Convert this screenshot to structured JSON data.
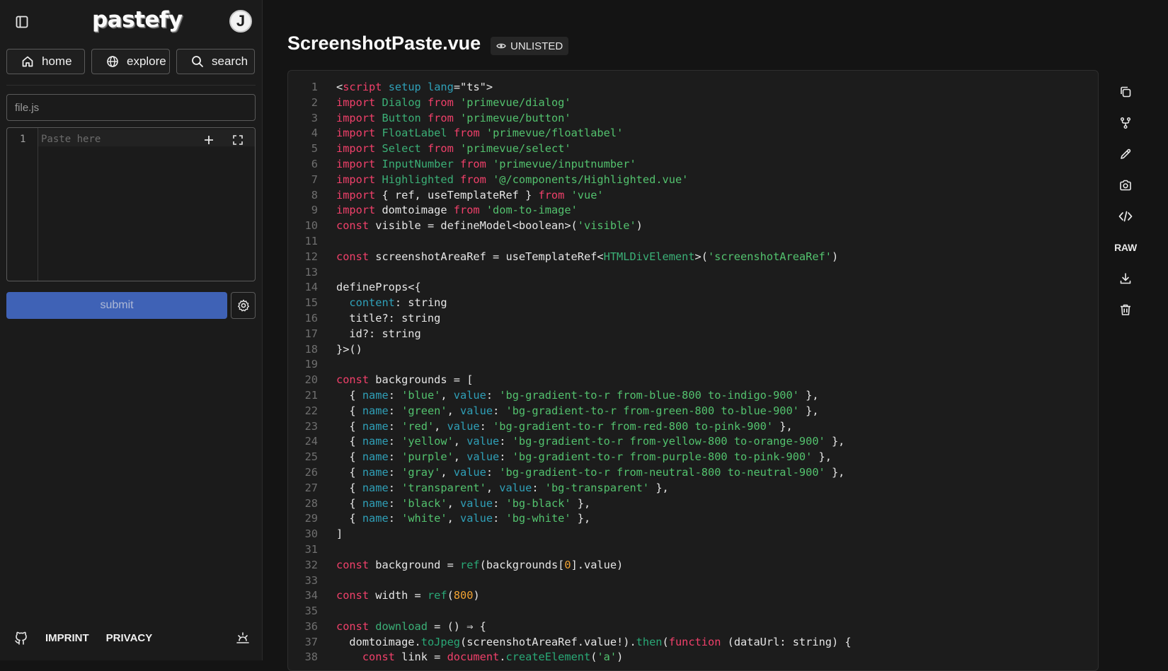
{
  "app": {
    "logo": "pastefy",
    "avatar_initial": "J"
  },
  "nav": {
    "home": "home",
    "explore": "explore",
    "search": "search"
  },
  "editor": {
    "filename_placeholder": "file.js",
    "line_number": "1",
    "paste_placeholder": "Paste here",
    "submit_label": "submit"
  },
  "footer": {
    "imprint": "IMPRINT",
    "privacy": "PRIVACY"
  },
  "paste": {
    "title": "ScreenshotPaste.vue",
    "visibility": "UNLISTED"
  },
  "actions": {
    "raw_label": "RAW"
  },
  "icons": {
    "sidebar_toggle": "sidebar-toggle-icon",
    "home": "home-icon",
    "explore": "globe-icon",
    "search": "search-icon",
    "add": "plus-icon",
    "fullscreen": "fullscreen-icon",
    "settings": "gear-icon",
    "github": "github-icon",
    "theme": "theme-icon",
    "visibility": "eye-icon",
    "copy": "copy-icon",
    "fork": "fork-icon",
    "edit": "pencil-icon",
    "screenshot": "camera-icon",
    "embed": "code-icon",
    "download": "download-icon",
    "delete": "trash-icon"
  },
  "colors": {
    "background": "#141414",
    "sidebar": "#1b1b1b",
    "submit": "#3f62b6",
    "keyword": "#f0406a",
    "string": "#53c26e",
    "identifier": "#3bb077",
    "property": "#2fa0b8",
    "number": "#f2a332"
  },
  "code_lines": [
    [
      {
        "t": "<",
        "c": ""
      },
      {
        "t": "script",
        "c": "kw"
      },
      {
        "t": " ",
        "c": ""
      },
      {
        "t": "setup",
        "c": "prop"
      },
      {
        "t": " ",
        "c": ""
      },
      {
        "t": "lang",
        "c": "prop"
      },
      {
        "t": "=\"ts\">",
        "c": ""
      }
    ],
    [
      {
        "t": "import",
        "c": "kw"
      },
      {
        "t": " ",
        "c": ""
      },
      {
        "t": "Dialog",
        "c": "id"
      },
      {
        "t": " ",
        "c": ""
      },
      {
        "t": "from",
        "c": "kw"
      },
      {
        "t": " ",
        "c": ""
      },
      {
        "t": "'primevue/dialog'",
        "c": "str"
      }
    ],
    [
      {
        "t": "import",
        "c": "kw"
      },
      {
        "t": " ",
        "c": ""
      },
      {
        "t": "Button",
        "c": "id"
      },
      {
        "t": " ",
        "c": ""
      },
      {
        "t": "from",
        "c": "kw"
      },
      {
        "t": " ",
        "c": ""
      },
      {
        "t": "'primevue/button'",
        "c": "str"
      }
    ],
    [
      {
        "t": "import",
        "c": "kw"
      },
      {
        "t": " ",
        "c": ""
      },
      {
        "t": "FloatLabel",
        "c": "id"
      },
      {
        "t": " ",
        "c": ""
      },
      {
        "t": "from",
        "c": "kw"
      },
      {
        "t": " ",
        "c": ""
      },
      {
        "t": "'primevue/floatlabel'",
        "c": "str"
      }
    ],
    [
      {
        "t": "import",
        "c": "kw"
      },
      {
        "t": " ",
        "c": ""
      },
      {
        "t": "Select",
        "c": "id"
      },
      {
        "t": " ",
        "c": ""
      },
      {
        "t": "from",
        "c": "kw"
      },
      {
        "t": " ",
        "c": ""
      },
      {
        "t": "'primevue/select'",
        "c": "str"
      }
    ],
    [
      {
        "t": "import",
        "c": "kw"
      },
      {
        "t": " ",
        "c": ""
      },
      {
        "t": "InputNumber",
        "c": "id"
      },
      {
        "t": " ",
        "c": ""
      },
      {
        "t": "from",
        "c": "kw"
      },
      {
        "t": " ",
        "c": ""
      },
      {
        "t": "'primevue/inputnumber'",
        "c": "str"
      }
    ],
    [
      {
        "t": "import",
        "c": "kw"
      },
      {
        "t": " ",
        "c": ""
      },
      {
        "t": "Highlighted",
        "c": "id"
      },
      {
        "t": " ",
        "c": ""
      },
      {
        "t": "from",
        "c": "kw"
      },
      {
        "t": " ",
        "c": ""
      },
      {
        "t": "'@/components/Highlighted.vue'",
        "c": "str"
      }
    ],
    [
      {
        "t": "import",
        "c": "kw"
      },
      {
        "t": " { ref, useTemplateRef } ",
        "c": ""
      },
      {
        "t": "from",
        "c": "kw"
      },
      {
        "t": " ",
        "c": ""
      },
      {
        "t": "'vue'",
        "c": "str"
      }
    ],
    [
      {
        "t": "import",
        "c": "kw"
      },
      {
        "t": " domtoimage ",
        "c": ""
      },
      {
        "t": "from",
        "c": "kw"
      },
      {
        "t": " ",
        "c": ""
      },
      {
        "t": "'dom-to-image'",
        "c": "str"
      }
    ],
    [
      {
        "t": "const",
        "c": "kw"
      },
      {
        "t": " visible = defineModel<boolean>(",
        "c": ""
      },
      {
        "t": "'visible'",
        "c": "str"
      },
      {
        "t": ")",
        "c": ""
      }
    ],
    [],
    [
      {
        "t": "const",
        "c": "kw"
      },
      {
        "t": " screenshotAreaRef = useTemplateRef<",
        "c": ""
      },
      {
        "t": "HTMLDivElement",
        "c": "id"
      },
      {
        "t": ">(",
        "c": ""
      },
      {
        "t": "'screenshotAreaRef'",
        "c": "str"
      },
      {
        "t": ")",
        "c": ""
      }
    ],
    [],
    [
      {
        "t": "defineProps<{",
        "c": ""
      }
    ],
    [
      {
        "t": "  ",
        "c": ""
      },
      {
        "t": "content",
        "c": "prop"
      },
      {
        "t": ": string",
        "c": ""
      }
    ],
    [
      {
        "t": "  title?: string",
        "c": ""
      }
    ],
    [
      {
        "t": "  id?: string",
        "c": ""
      }
    ],
    [
      {
        "t": "}>()",
        "c": ""
      }
    ],
    [],
    [
      {
        "t": "const",
        "c": "kw"
      },
      {
        "t": " backgrounds = [",
        "c": ""
      }
    ],
    [
      {
        "t": "  { ",
        "c": ""
      },
      {
        "t": "name",
        "c": "prop"
      },
      {
        "t": ": ",
        "c": ""
      },
      {
        "t": "'blue'",
        "c": "str"
      },
      {
        "t": ", ",
        "c": ""
      },
      {
        "t": "value",
        "c": "prop"
      },
      {
        "t": ": ",
        "c": ""
      },
      {
        "t": "'bg-gradient-to-r from-blue-800 to-indigo-900'",
        "c": "str"
      },
      {
        "t": " },",
        "c": ""
      }
    ],
    [
      {
        "t": "  { ",
        "c": ""
      },
      {
        "t": "name",
        "c": "prop"
      },
      {
        "t": ": ",
        "c": ""
      },
      {
        "t": "'green'",
        "c": "str"
      },
      {
        "t": ", ",
        "c": ""
      },
      {
        "t": "value",
        "c": "prop"
      },
      {
        "t": ": ",
        "c": ""
      },
      {
        "t": "'bg-gradient-to-r from-green-800 to-blue-900'",
        "c": "str"
      },
      {
        "t": " },",
        "c": ""
      }
    ],
    [
      {
        "t": "  { ",
        "c": ""
      },
      {
        "t": "name",
        "c": "prop"
      },
      {
        "t": ": ",
        "c": ""
      },
      {
        "t": "'red'",
        "c": "str"
      },
      {
        "t": ", ",
        "c": ""
      },
      {
        "t": "value",
        "c": "prop"
      },
      {
        "t": ": ",
        "c": ""
      },
      {
        "t": "'bg-gradient-to-r from-red-800 to-pink-900'",
        "c": "str"
      },
      {
        "t": " },",
        "c": ""
      }
    ],
    [
      {
        "t": "  { ",
        "c": ""
      },
      {
        "t": "name",
        "c": "prop"
      },
      {
        "t": ": ",
        "c": ""
      },
      {
        "t": "'yellow'",
        "c": "str"
      },
      {
        "t": ", ",
        "c": ""
      },
      {
        "t": "value",
        "c": "prop"
      },
      {
        "t": ": ",
        "c": ""
      },
      {
        "t": "'bg-gradient-to-r from-yellow-800 to-orange-900'",
        "c": "str"
      },
      {
        "t": " },",
        "c": ""
      }
    ],
    [
      {
        "t": "  { ",
        "c": ""
      },
      {
        "t": "name",
        "c": "prop"
      },
      {
        "t": ": ",
        "c": ""
      },
      {
        "t": "'purple'",
        "c": "str"
      },
      {
        "t": ", ",
        "c": ""
      },
      {
        "t": "value",
        "c": "prop"
      },
      {
        "t": ": ",
        "c": ""
      },
      {
        "t": "'bg-gradient-to-r from-purple-800 to-pink-900'",
        "c": "str"
      },
      {
        "t": " },",
        "c": ""
      }
    ],
    [
      {
        "t": "  { ",
        "c": ""
      },
      {
        "t": "name",
        "c": "prop"
      },
      {
        "t": ": ",
        "c": ""
      },
      {
        "t": "'gray'",
        "c": "str"
      },
      {
        "t": ", ",
        "c": ""
      },
      {
        "t": "value",
        "c": "prop"
      },
      {
        "t": ": ",
        "c": ""
      },
      {
        "t": "'bg-gradient-to-r from-neutral-800 to-neutral-900'",
        "c": "str"
      },
      {
        "t": " },",
        "c": ""
      }
    ],
    [
      {
        "t": "  { ",
        "c": ""
      },
      {
        "t": "name",
        "c": "prop"
      },
      {
        "t": ": ",
        "c": ""
      },
      {
        "t": "'transparent'",
        "c": "str"
      },
      {
        "t": ", ",
        "c": ""
      },
      {
        "t": "value",
        "c": "prop"
      },
      {
        "t": ": ",
        "c": ""
      },
      {
        "t": "'bg-transparent'",
        "c": "str"
      },
      {
        "t": " },",
        "c": ""
      }
    ],
    [
      {
        "t": "  { ",
        "c": ""
      },
      {
        "t": "name",
        "c": "prop"
      },
      {
        "t": ": ",
        "c": ""
      },
      {
        "t": "'black'",
        "c": "str"
      },
      {
        "t": ", ",
        "c": ""
      },
      {
        "t": "value",
        "c": "prop"
      },
      {
        "t": ": ",
        "c": ""
      },
      {
        "t": "'bg-black'",
        "c": "str"
      },
      {
        "t": " },",
        "c": ""
      }
    ],
    [
      {
        "t": "  { ",
        "c": ""
      },
      {
        "t": "name",
        "c": "prop"
      },
      {
        "t": ": ",
        "c": ""
      },
      {
        "t": "'white'",
        "c": "str"
      },
      {
        "t": ", ",
        "c": ""
      },
      {
        "t": "value",
        "c": "prop"
      },
      {
        "t": ": ",
        "c": ""
      },
      {
        "t": "'bg-white'",
        "c": "str"
      },
      {
        "t": " },",
        "c": ""
      }
    ],
    [
      {
        "t": "]",
        "c": ""
      }
    ],
    [],
    [
      {
        "t": "const",
        "c": "kw"
      },
      {
        "t": " background = ",
        "c": ""
      },
      {
        "t": "ref",
        "c": "fn"
      },
      {
        "t": "(backgrounds[",
        "c": ""
      },
      {
        "t": "0",
        "c": "num"
      },
      {
        "t": "].value)",
        "c": ""
      }
    ],
    [],
    [
      {
        "t": "const",
        "c": "kw"
      },
      {
        "t": " width = ",
        "c": ""
      },
      {
        "t": "ref",
        "c": "fn"
      },
      {
        "t": "(",
        "c": ""
      },
      {
        "t": "800",
        "c": "num"
      },
      {
        "t": ")",
        "c": ""
      }
    ],
    [],
    [
      {
        "t": "const",
        "c": "kw"
      },
      {
        "t": " ",
        "c": ""
      },
      {
        "t": "download",
        "c": "id"
      },
      {
        "t": " = () ⇒ {",
        "c": ""
      }
    ],
    [
      {
        "t": "  domtoimage.",
        "c": ""
      },
      {
        "t": "toJpeg",
        "c": "fn"
      },
      {
        "t": "(screenshotAreaRef.value!).",
        "c": ""
      },
      {
        "t": "then",
        "c": "fn"
      },
      {
        "t": "(",
        "c": ""
      },
      {
        "t": "function",
        "c": "kw"
      },
      {
        "t": " (dataUrl: string) {",
        "c": ""
      }
    ],
    [
      {
        "t": "    ",
        "c": ""
      },
      {
        "t": "const",
        "c": "kw"
      },
      {
        "t": " link = ",
        "c": ""
      },
      {
        "t": "document",
        "c": "kw"
      },
      {
        "t": ".",
        "c": ""
      },
      {
        "t": "createElement",
        "c": "fn"
      },
      {
        "t": "(",
        "c": ""
      },
      {
        "t": "'a'",
        "c": "str"
      },
      {
        "t": ")",
        "c": ""
      }
    ]
  ]
}
